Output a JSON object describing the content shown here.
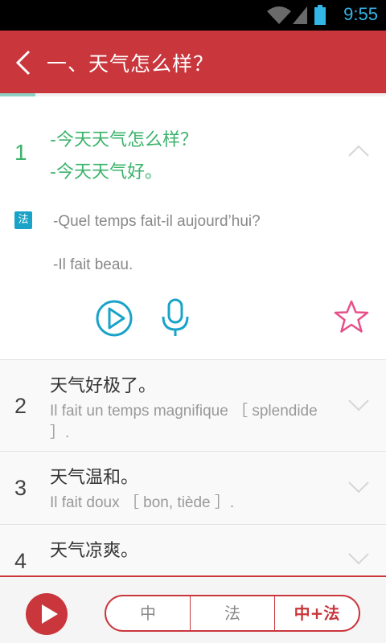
{
  "status_bar": {
    "time": "9:55",
    "icons": [
      "wifi-icon",
      "signal-icon",
      "battery-icon"
    ]
  },
  "header": {
    "title": "一、天气怎么样？",
    "back_icon": "chevron-left-icon",
    "color": "#c9363c"
  },
  "items": [
    {
      "number": "1",
      "zh_lines": [
        "-今天天气怎么样？",
        "-今天天气好。"
      ],
      "fr_badge": "法",
      "fr_lines": [
        "-Quel temps fait-il aujourd’hui?",
        "-Il fait beau."
      ],
      "expanded": true
    },
    {
      "number": "2",
      "zh": "天气好极了。",
      "fr": "Il fait un temps magnifique ［ splendide ］."
    },
    {
      "number": "3",
      "zh": "天气温和。",
      "fr": "Il fait doux ［ bon, tiède ］."
    },
    {
      "number": "4",
      "zh": "天气凉爽。",
      "fr": ""
    }
  ],
  "bottom_bar": {
    "play_icon": "play-icon",
    "modes": [
      "中",
      "法",
      "中+法"
    ],
    "active_mode": "中+法"
  },
  "colors": {
    "accent": "#c9363c",
    "green": "#3bb36b",
    "blue": "#1aa3c8",
    "star": "#e8508a"
  }
}
